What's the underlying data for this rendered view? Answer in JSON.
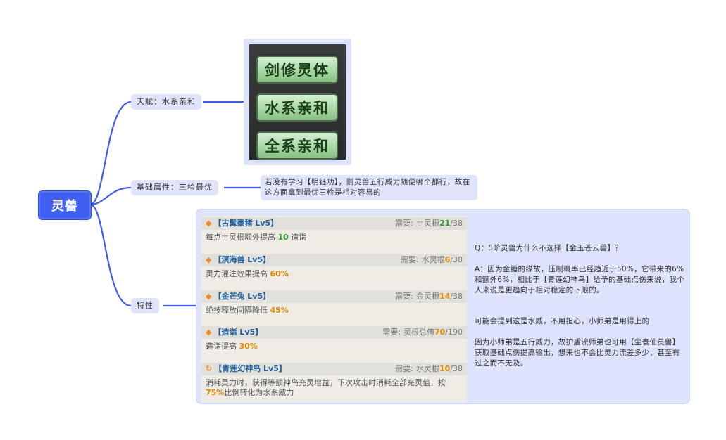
{
  "root": {
    "label": "灵兽"
  },
  "branches": {
    "talent": {
      "label": "天赋：水系亲和",
      "badges": [
        "剑修灵体",
        "水系亲和",
        "全系亲和"
      ]
    },
    "base": {
      "label": "基础属性：三检最优",
      "note": "若没有学习【明钰功】，则灵兽五行威力随便哪个都行，故在这方面拿到最优三检是相对容易的"
    },
    "traits": {
      "label": "特性"
    }
  },
  "beasts": [
    {
      "name": "【古髯豪猪 Lv5】",
      "need": "需要:",
      "req_label": "土灵根",
      "req_val": "21",
      "req_total": "/38",
      "val_color": "#2b9a2b",
      "desc_pre": "每点土灵根额外提高 ",
      "desc_val": "10",
      "desc_post": " 造诣",
      "desc_color": "#2b9a2b",
      "icon": "diamond-icon"
    },
    {
      "name": "【溟海兽 Lv5】",
      "need": "需要:",
      "req_label": "水灵根",
      "req_val": "6",
      "req_total": "/38",
      "val_color": "#e08a00",
      "desc_pre": "灵力灌注效果提高 ",
      "desc_val": "60%",
      "desc_post": "",
      "desc_color": "#e08a00",
      "icon": "diamond-icon"
    },
    {
      "name": "【金芒兔 Lv5】",
      "need": "需要:",
      "req_label": "金灵根",
      "req_val": "14",
      "req_total": "/38",
      "val_color": "#e08a00",
      "desc_pre": "绝技释放间隔降低 ",
      "desc_val": "45%",
      "desc_post": "",
      "desc_color": "#e08a00",
      "icon": "diamond-icon"
    },
    {
      "name": "【造诣 Lv5】",
      "need": "需要:",
      "req_label": "灵根总值",
      "req_val": "70",
      "req_total": "/190",
      "val_color": "#e08a00",
      "desc_pre": "造诣提高 ",
      "desc_val": "30%",
      "desc_post": "",
      "desc_color": "#e08a00",
      "icon": "diamond-icon"
    },
    {
      "name": "【青莲幻神鸟 Lv5】",
      "need": "需要:",
      "req_label": "水灵根",
      "req_val": "10",
      "req_total": "/38",
      "val_color": "#e08a00",
      "desc_pre": "消耗灵力时，获得等额神鸟充灵增益，下次攻击时消耗全部充灵值，按 ",
      "desc_val": "75%",
      "desc_post": "比例转化为水系威力",
      "desc_color": "#e08a00",
      "icon": "refresh-icon"
    }
  ],
  "qa": {
    "q": "Q：5阶灵兽为什么不选择【金玉苍云兽】？",
    "a": "A：因为金锤的缘故，压制概率已经趋近于50%，它带来的6%和额外6%，相比于【青莲幻神鸟】给予的基础点伤来说，我个人来说是更趋向于相对稳定的下限的。",
    "p2": "可能会提到这是水威，不用担心，小师弟是用得上的",
    "p3": "因为小师弟是五行威力，故护盾流师弟也可用【尘寰仙灵兽】获取基础点伤提高输出，想来也不会比灵力流差多少，甚至有过之而不无及。"
  },
  "colors": {
    "root": "#3f60f0",
    "connector": "#3f5de8",
    "node_bg": "#dfe4fb"
  }
}
